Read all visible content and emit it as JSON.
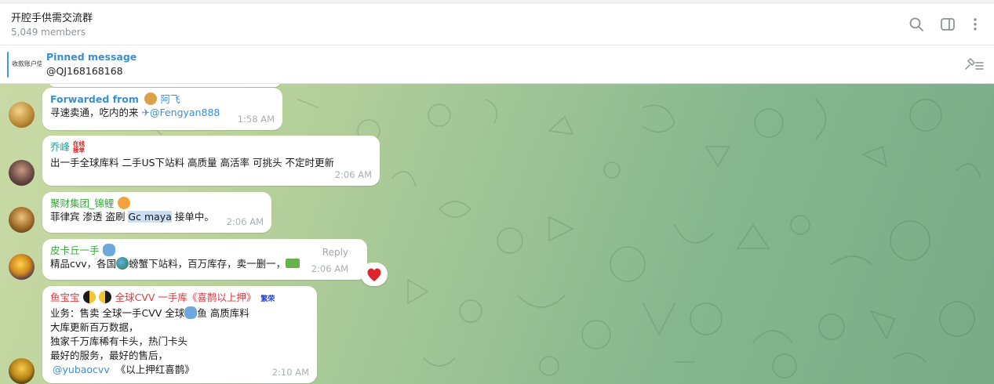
{
  "header": {
    "title": "开腔手供需交流群",
    "members": "5,049 members",
    "icons": [
      "search-icon",
      "sidebar-toggle-icon",
      "more-vertical-icon"
    ]
  },
  "pinned": {
    "title": "Pinned message",
    "text": "@QJ168168168",
    "thumb_text": "收款账户信"
  },
  "messages": [
    {
      "forward_label": "Forwarded from",
      "forward_name": "阿飞",
      "text": "寻速卖通，吃内的来",
      "mention": "@Fengyan888",
      "time": "1:58 AM"
    },
    {
      "sender": "乔峰",
      "badge_line1": "在线",
      "badge_line2": "接单",
      "text": "出一手全球库料  二手US下站料  高质量 高活率  可挑头  不定时更新",
      "time": "2:06 AM"
    },
    {
      "sender": "聚财集团_锦鲤",
      "text_before": "菲律宾  渗透 盗刷 ",
      "text_selected": "Gc maya",
      "text_after": " 接单中。",
      "time": "2:06 AM"
    },
    {
      "sender": "皮卡丘一手",
      "reply_label": "Reply",
      "text_a": "精品cvv，各国",
      "text_b": "螃蟹下站料，百万库存，卖一删一，",
      "time": "2:06 AM",
      "reaction": "❤️"
    },
    {
      "sender": "鱼宝宝",
      "sender_tail": "全球CVV 一手库《喜鹊以上押》",
      "badge": "繁荣",
      "line1_a": "业务：售卖 全球一手CVV    全球",
      "line1_b": "鱼      高质库料",
      "line2": "大库更新百万数据，",
      "line3": "独家千万库稀有卡头，热门卡头",
      "line4": "最好的服务，最好的售后，",
      "mention": "@yubaocvv",
      "line5_tail": "《以上押红喜鹊》",
      "time": "2:10 AM"
    }
  ],
  "colors": {
    "accent": "#3a8fd1",
    "sender_green": "#36a93b",
    "sender_red": "#e0393e",
    "sender_teal": "#1aa39a"
  }
}
